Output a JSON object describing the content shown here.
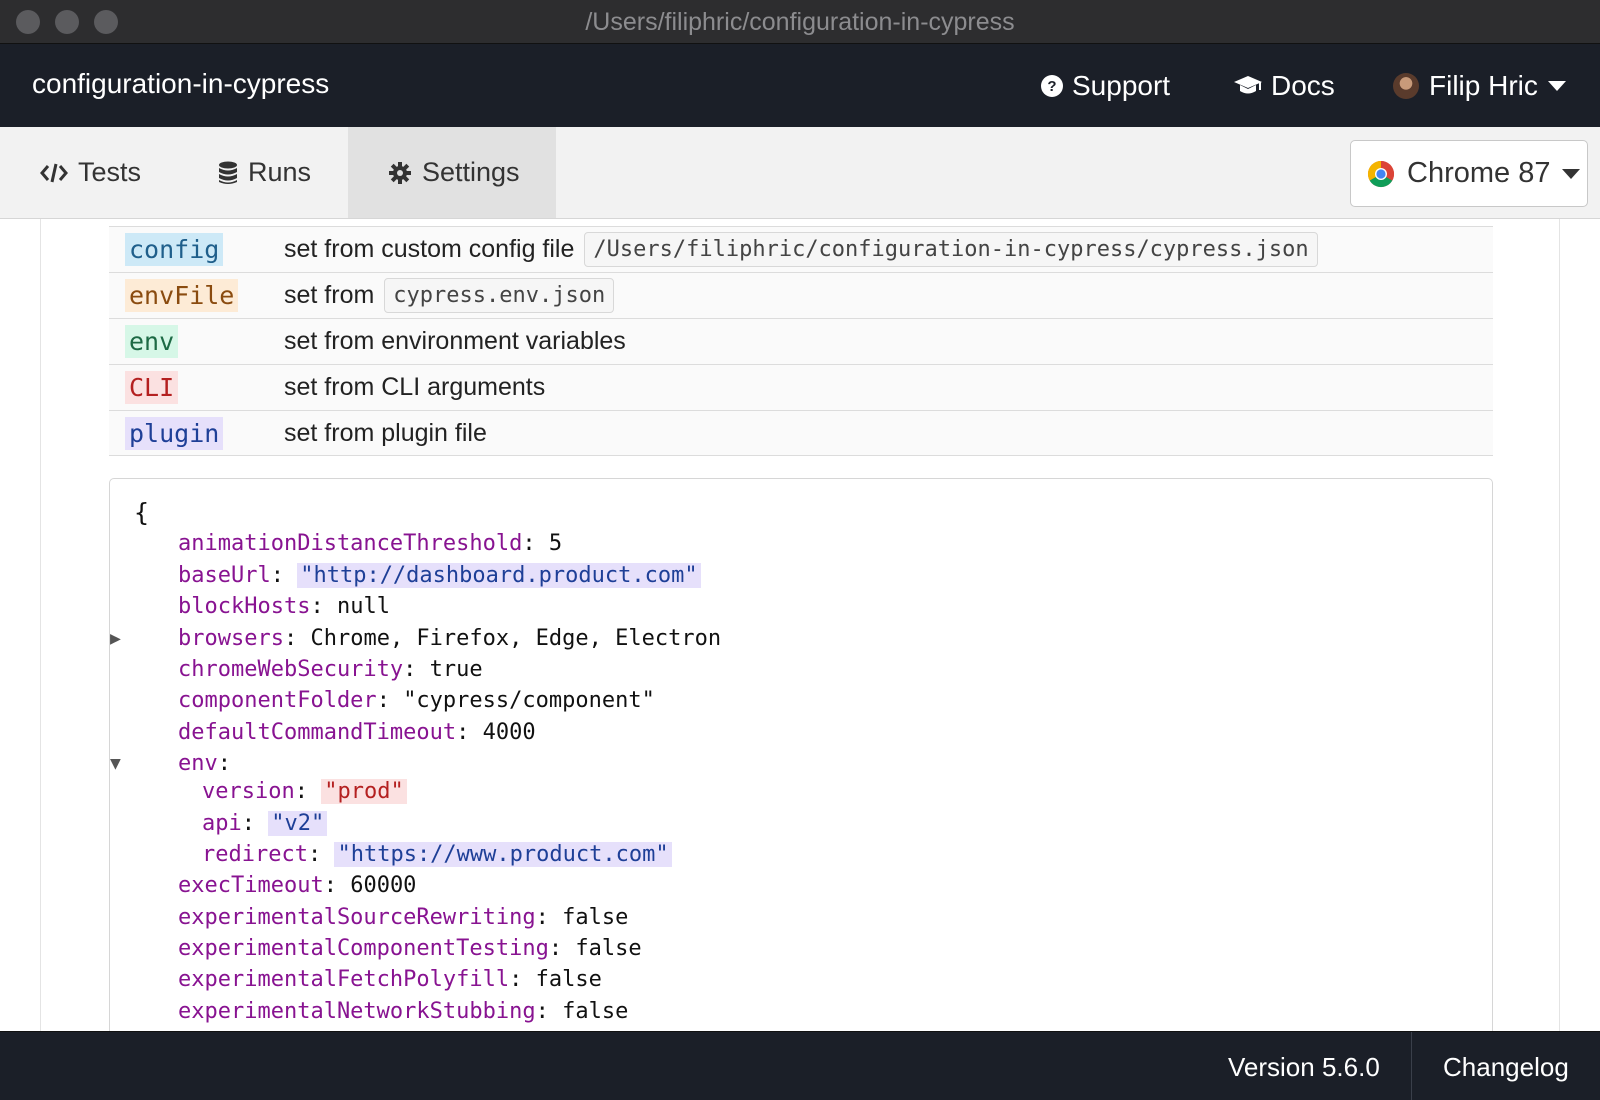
{
  "window": {
    "title": "/Users/filiphric/configuration-in-cypress"
  },
  "header": {
    "project_name": "configuration-in-cypress",
    "support_label": "Support",
    "docs_label": "Docs",
    "user_name": "Filip Hric"
  },
  "tabs": [
    {
      "label": "Tests",
      "icon": "code-icon"
    },
    {
      "label": "Runs",
      "icon": "database-icon"
    },
    {
      "label": "Settings",
      "icon": "gear-icon",
      "active": true
    }
  ],
  "browser": {
    "selected": "Chrome 87"
  },
  "legend": [
    {
      "tag": "config",
      "desc": "set from custom config file",
      "chip": "/Users/filiphric/configuration-in-cypress/cypress.json"
    },
    {
      "tag": "envFile",
      "desc": "set from",
      "chip": "cypress.env.json"
    },
    {
      "tag": "env",
      "desc": "set from environment variables"
    },
    {
      "tag": "CLI",
      "desc": "set from CLI arguments"
    },
    {
      "tag": "plugin",
      "desc": "set from plugin file"
    }
  ],
  "config": {
    "open_brace": "{",
    "entries": [
      {
        "key": "animationDistanceThreshold",
        "value": "5"
      },
      {
        "key": "baseUrl",
        "value": "\"http://dashboard.product.com\""
      },
      {
        "key": "blockHosts",
        "value": "null"
      },
      {
        "key": "browsers",
        "value": "Chrome, Firefox, Edge, Electron"
      },
      {
        "key": "chromeWebSecurity",
        "value": "true"
      },
      {
        "key": "componentFolder",
        "value": "\"cypress/component\""
      },
      {
        "key": "defaultCommandTimeout",
        "value": "4000"
      },
      {
        "key": "env",
        "value": ""
      },
      {
        "key": "version",
        "value": "\"prod\""
      },
      {
        "key": "api",
        "value": "\"v2\""
      },
      {
        "key": "redirect",
        "value": "\"https://www.product.com\""
      },
      {
        "key": "execTimeout",
        "value": "60000"
      },
      {
        "key": "experimentalSourceRewriting",
        "value": "false"
      },
      {
        "key": "experimentalComponentTesting",
        "value": "false"
      },
      {
        "key": "experimentalFetchPolyfill",
        "value": "false"
      },
      {
        "key": "experimentalNetworkStubbing",
        "value": "false"
      }
    ]
  },
  "footer": {
    "version": "Version 5.6.0",
    "changelog": "Changelog"
  }
}
